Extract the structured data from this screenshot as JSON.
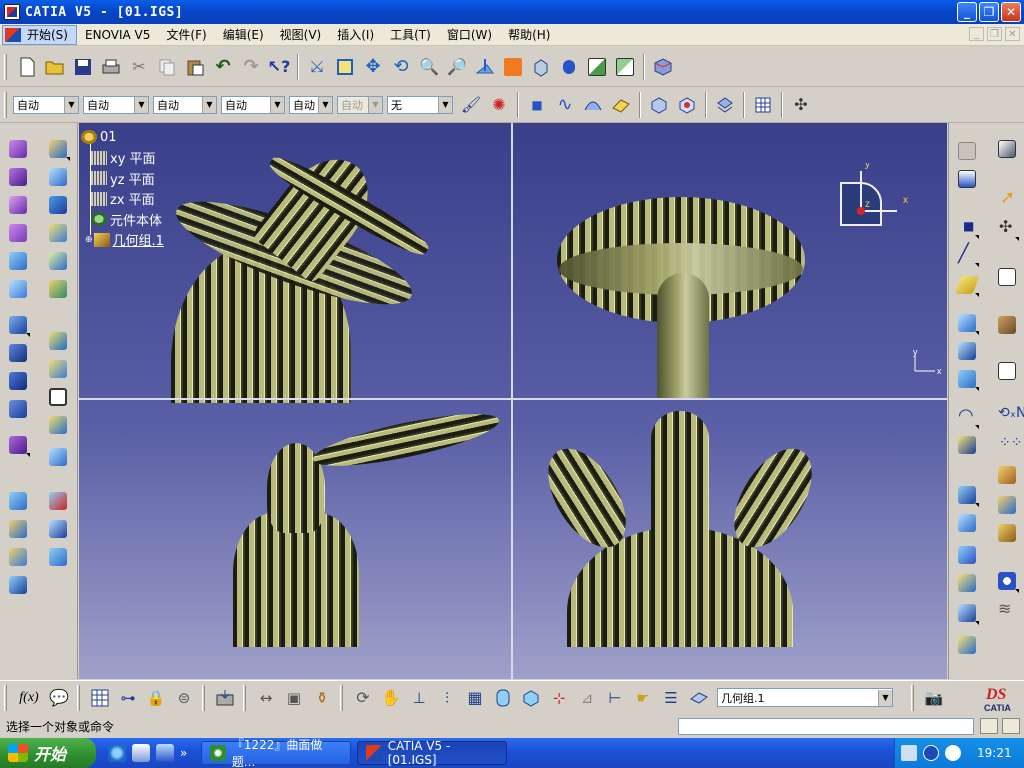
{
  "window": {
    "title": "CATIA V5 - [01.IGS]"
  },
  "menu": {
    "start": "开始(S)",
    "items": [
      "ENOVIA V5",
      "文件(F)",
      "编辑(E)",
      "视图(V)",
      "插入(I)",
      "工具(T)",
      "窗口(W)",
      "帮助(H)"
    ]
  },
  "graphic_properties": {
    "combo1": "自动",
    "combo2": "自动",
    "combo3": "自动",
    "combo4": "自动",
    "combo5": "自动",
    "combo6": "自动",
    "combo7": "无"
  },
  "tree": {
    "root": "01",
    "nodes": [
      "xy 平面",
      "yz 平面",
      "zx 平面",
      "元件本体",
      "几何组.1"
    ]
  },
  "compass": {
    "y": "y",
    "x": "x",
    "z": "z"
  },
  "axis_small": {
    "y": "y",
    "x": "x"
  },
  "bottom_toolbar": {
    "fx": "f(x)",
    "current_body": "几何组.1"
  },
  "status": {
    "message": "选择一个对象或命令"
  },
  "taskbar": {
    "start": "开始",
    "tasks": [
      "『1222』曲面做题...",
      "CATIA V5 - [01.IGS]"
    ],
    "clock": "19:21"
  },
  "colors": {
    "title_blue": "#0645c6",
    "viewport_top": "#3a3f8a",
    "viewport_bottom": "#9fa0c9",
    "zebra_light": "#e7e8b5",
    "zebra_dark": "#1b1d13"
  }
}
